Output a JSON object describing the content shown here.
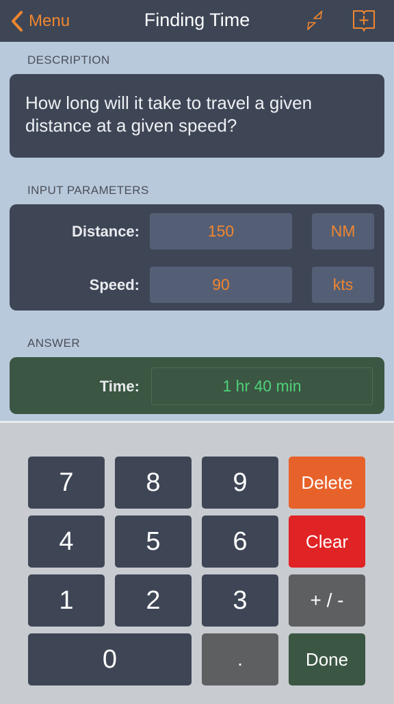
{
  "navbar": {
    "back_label": "Menu",
    "title": "Finding Time",
    "icons": {
      "back": "chevron-left-icon",
      "collapse": "collapse-arrows-icon",
      "bookmark": "add-to-book-icon"
    },
    "accent_color": "#f0862f"
  },
  "description": {
    "header": "DESCRIPTION",
    "text": "How long will it take to travel a given distance at a given speed?"
  },
  "inputs": {
    "header": "INPUT PARAMETERS",
    "distance": {
      "label": "Distance:",
      "value": "150",
      "unit": "NM"
    },
    "speed": {
      "label": "Speed:",
      "value": "90",
      "unit": "kts"
    }
  },
  "answer": {
    "header": "ANSWER",
    "label": "Time:",
    "value": "1 hr 40 min"
  },
  "keypad": {
    "k7": "7",
    "k8": "8",
    "k9": "9",
    "k4": "4",
    "k5": "5",
    "k6": "6",
    "k1": "1",
    "k2": "2",
    "k3": "3",
    "k0": "0",
    "dot": ".",
    "delete": "Delete",
    "clear": "Clear",
    "sign": "+ / -",
    "done": "Done"
  }
}
